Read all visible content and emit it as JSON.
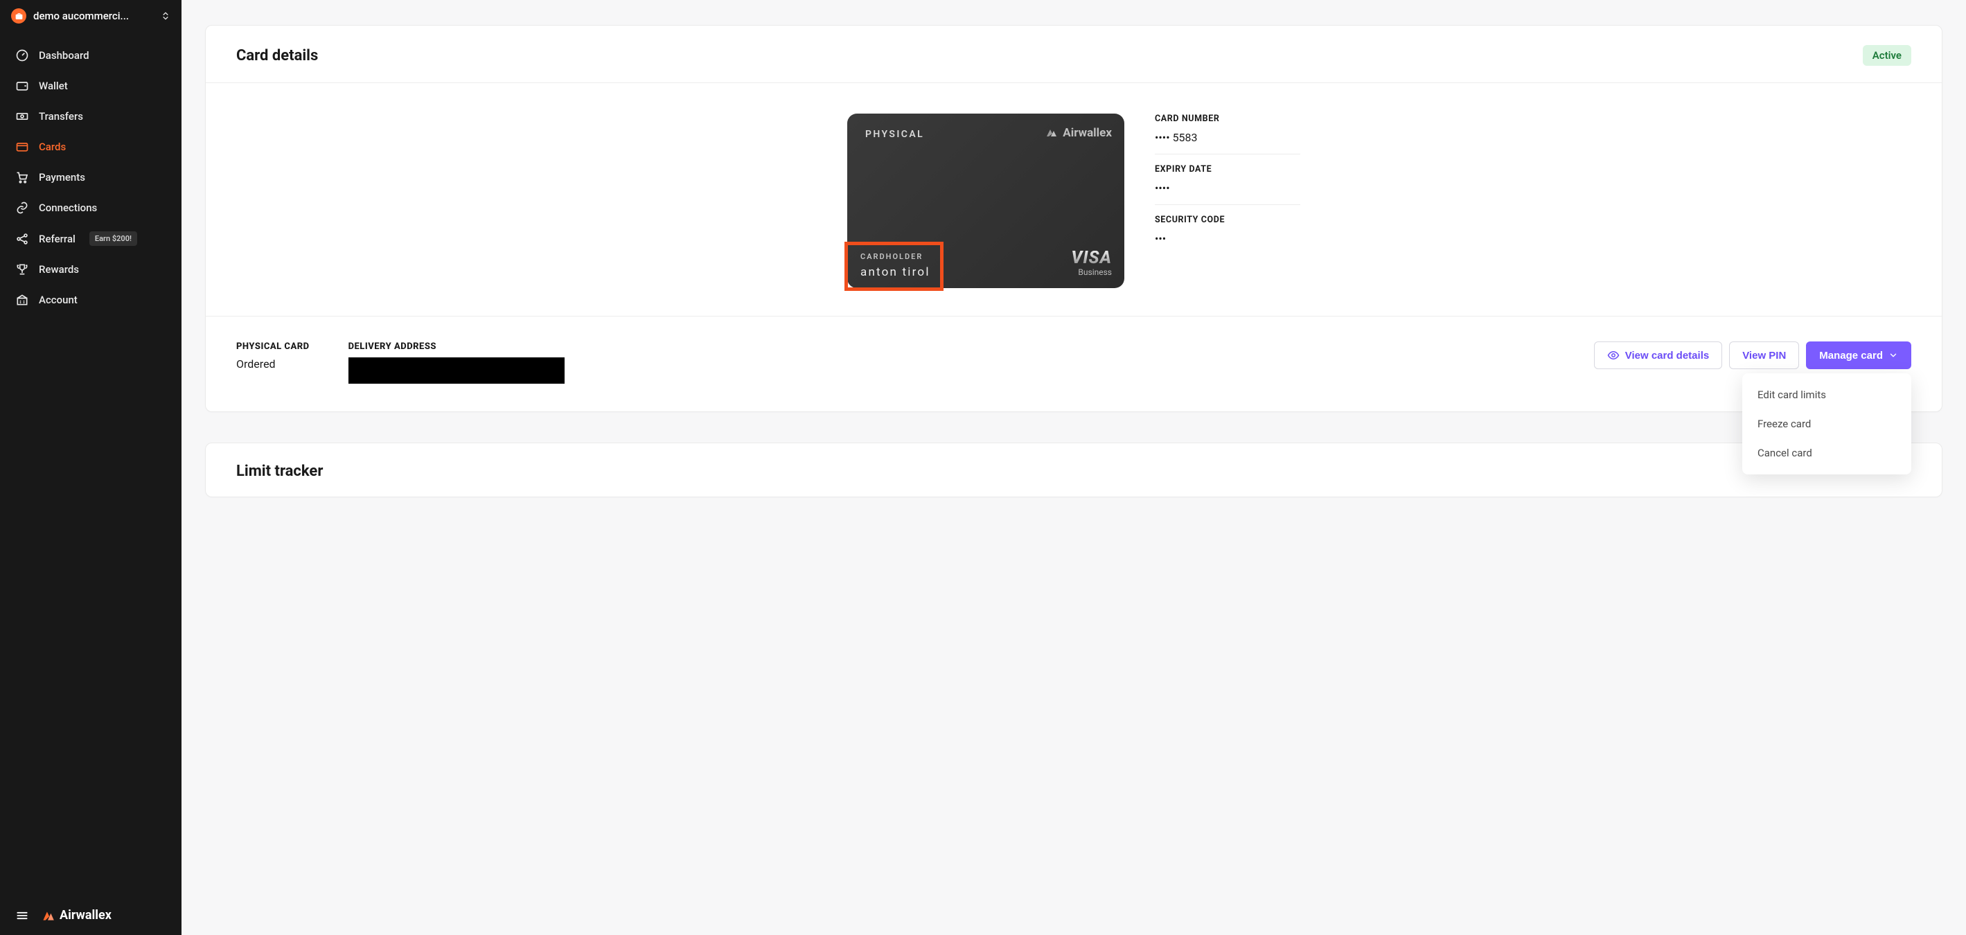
{
  "org": {
    "name": "demo aucommerci..."
  },
  "sidebar": {
    "items": [
      {
        "label": "Dashboard",
        "icon": "gauge-icon"
      },
      {
        "label": "Wallet",
        "icon": "wallet-icon"
      },
      {
        "label": "Transfers",
        "icon": "transfers-icon"
      },
      {
        "label": "Cards",
        "icon": "card-icon",
        "active": true
      },
      {
        "label": "Payments",
        "icon": "payments-icon"
      },
      {
        "label": "Connections",
        "icon": "connections-icon"
      },
      {
        "label": "Referral",
        "icon": "referral-icon",
        "badge": "Earn $200!"
      },
      {
        "label": "Rewards",
        "icon": "rewards-icon"
      },
      {
        "label": "Account",
        "icon": "account-icon"
      }
    ],
    "brand": "Airwallex"
  },
  "card_details": {
    "title": "Card details",
    "status": "Active",
    "card": {
      "type": "PHYSICAL",
      "brand": "Airwallex",
      "network": "VISA",
      "network_sub": "Business",
      "cardholder_label": "CARDHOLDER",
      "cardholder_name": "anton tirol"
    },
    "meta": {
      "number_label": "CARD NUMBER",
      "number_value": "•••• 5583",
      "expiry_label": "EXPIRY DATE",
      "expiry_value": "••••",
      "code_label": "SECURITY CODE",
      "code_value": "•••"
    },
    "physical": {
      "label": "PHYSICAL CARD",
      "status": "Ordered",
      "delivery_label": "DELIVERY ADDRESS"
    },
    "actions": {
      "view_details": "View card details",
      "view_pin": "View PIN",
      "manage": "Manage card",
      "dropdown": [
        "Edit card limits",
        "Freeze card",
        "Cancel card"
      ]
    }
  },
  "limit_tracker": {
    "title": "Limit tracker"
  }
}
